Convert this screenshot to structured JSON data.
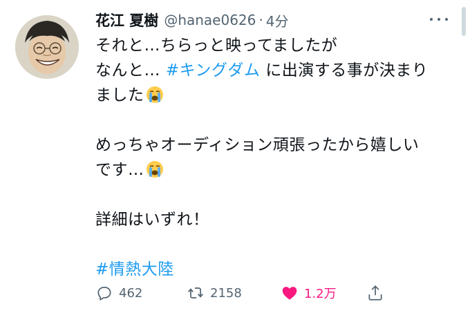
{
  "tweet": {
    "display_name": "花江 夏樹",
    "handle": "@hanae0626",
    "separator": "·",
    "time": "4分",
    "lines": {
      "l1": "それと…ちらっと映ってましたが",
      "l2_pre": "なんと… ",
      "l2_tag": "#キングダム",
      "l2_post": " に出演する事が決まり",
      "l3": "ました",
      "l4": "めっちゃオーディション頑張ったから嬉しい",
      "l5": "です…",
      "l6": "詳細はいずれ！",
      "hashtag": "#情熱大陸"
    },
    "emoji_name": "loudly-crying-face",
    "counts": {
      "replies": "462",
      "retweets": "2158",
      "likes": "1.2万"
    },
    "colors": {
      "link": "#1d9bf0",
      "like": "#f91880",
      "secondary": "#536471"
    }
  }
}
